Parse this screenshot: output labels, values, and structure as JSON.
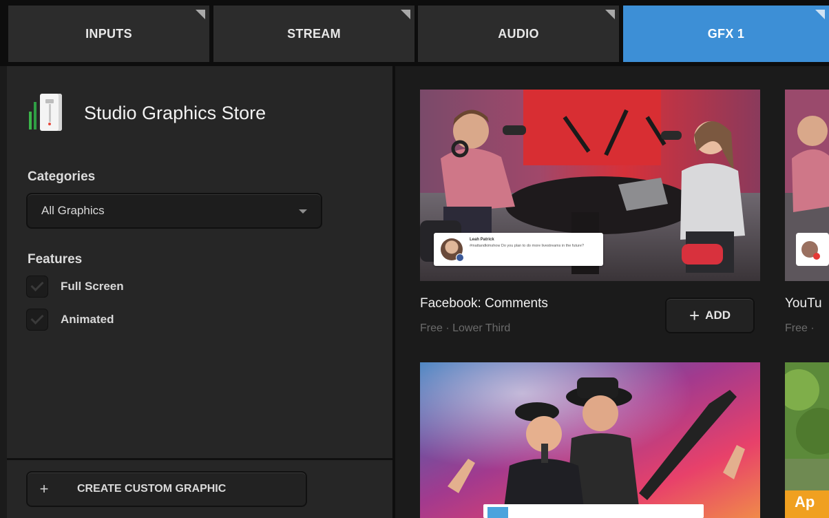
{
  "tabs": [
    {
      "label": "INPUTS",
      "active": false
    },
    {
      "label": "STREAM",
      "active": false
    },
    {
      "label": "AUDIO",
      "active": false
    },
    {
      "label": "GFX 1",
      "active": true
    }
  ],
  "sidebar": {
    "store_title": "Studio Graphics Store",
    "categories_label": "Categories",
    "category_selected": "All Graphics",
    "features_label": "Features",
    "features": [
      {
        "label": "Full Screen",
        "checked": false
      },
      {
        "label": "Animated",
        "checked": false
      }
    ],
    "create_button_label": "CREATE CUSTOM GRAPHIC"
  },
  "cards": [
    {
      "title": "Facebook: Comments",
      "subtitle": "Free · Lower Third",
      "add_label": "ADD",
      "lower_third": {
        "name": "Leah Patrick",
        "text": "#mattandkimshow Do you plan to do more livestreams in the future?"
      }
    },
    {
      "title": "YouTu",
      "subtitle": "Free ·"
    },
    {
      "title": "",
      "subtitle": ""
    },
    {
      "title": "",
      "subtitle": "",
      "overlay_text": "Ap"
    }
  ],
  "colors": {
    "accent": "#3d8fd6",
    "tab_bg": "#2c2c2c",
    "panel_bg": "#262626",
    "content_bg": "#1b1b1b"
  }
}
